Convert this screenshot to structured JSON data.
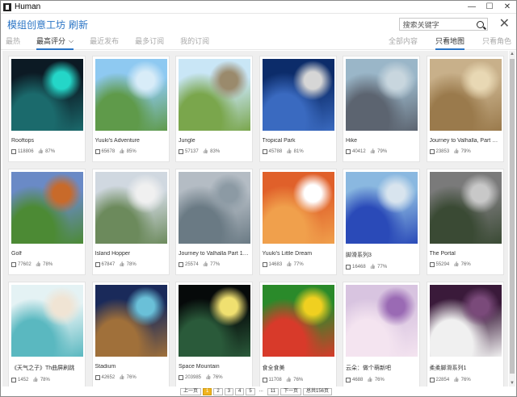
{
  "window": {
    "title": "Human",
    "minimize": "—",
    "maximize": "☐",
    "close": "✕"
  },
  "header": {
    "title": "模组创意工坊",
    "refresh": "刷新",
    "search_placeholder": "搜索关键字",
    "close": "✕"
  },
  "tabs": [
    "最热",
    "最高评分",
    "最近发布",
    "最多订阅",
    "我的订阅"
  ],
  "active_tab": "最高评分",
  "right_tabs": [
    "全部内容",
    "只看地图",
    "只看角色"
  ],
  "active_right_tab": "只看地图",
  "cards": [
    {
      "title": "Rooftops",
      "subs": "118806",
      "rating": "87%",
      "colors": [
        "#0c1a24",
        "#1b6a6c",
        "#24d6c8"
      ]
    },
    {
      "title": "Yuuki's Adventure",
      "subs": "65678",
      "rating": "85%",
      "colors": [
        "#8ec9f1",
        "#5f9a4a",
        "#d8ecf8"
      ]
    },
    {
      "title": "Jungle",
      "subs": "57137",
      "rating": "83%",
      "colors": [
        "#c9e6f6",
        "#7aa64c",
        "#9a8a6c"
      ]
    },
    {
      "title": "Tropical Park",
      "subs": "45788",
      "rating": "81%",
      "colors": [
        "#0c2c6a",
        "#3a6ac0",
        "#d6d6d6"
      ]
    },
    {
      "title": "Hike",
      "subs": "40412",
      "rating": "79%",
      "colors": [
        "#9ab6c8",
        "#5c6470",
        "#c8d6de"
      ]
    },
    {
      "title": "Journey to Valhalla, Part 6 (Jot...",
      "subs": "23853",
      "rating": "79%",
      "colors": [
        "#c8b08a",
        "#9a7a4c",
        "#e8d8b4"
      ]
    },
    {
      "title": "Golf",
      "subs": "77602",
      "rating": "78%",
      "colors": [
        "#6a8ac6",
        "#4c8a34",
        "#c86a2a"
      ]
    },
    {
      "title": "Island Hopper",
      "subs": "67847",
      "rating": "78%",
      "colors": [
        "#d0d8e0",
        "#6c8a5c",
        "#f0f0f0"
      ]
    },
    {
      "title": "Journey to Valhalla Part 1 (Mi...",
      "subs": "25574",
      "rating": "77%",
      "colors": [
        "#b4bcc4",
        "#6a7a84",
        "#8c9aa4"
      ]
    },
    {
      "title": "Yuuki's Little Dream",
      "subs": "14683",
      "rating": "77%",
      "colors": [
        "#e0602a",
        "#f0a04c",
        "#ffffff"
      ]
    },
    {
      "title": "脚滑系列3",
      "subs": "16468",
      "rating": "77%",
      "colors": [
        "#8ab8e0",
        "#2a4ab8",
        "#d8e4ee"
      ]
    },
    {
      "title": "The Portal",
      "subs": "55294",
      "rating": "76%",
      "colors": [
        "#7a7a7a",
        "#3a4a34",
        "#c8c8c8"
      ]
    },
    {
      "title": "《天气之子》Th曲屏刷跳",
      "subs": "1452",
      "rating": "78%",
      "colors": [
        "#e4f2f4",
        "#5ab8c0",
        "#f0e4d4"
      ]
    },
    {
      "title": "Stadium",
      "subs": "42652",
      "rating": "76%",
      "colors": [
        "#1a2a5a",
        "#a0703a",
        "#6ac0d8"
      ]
    },
    {
      "title": "Space Mountain",
      "subs": "203985",
      "rating": "76%",
      "colors": [
        "#060a0a",
        "#2a5a3a",
        "#f0e070"
      ]
    },
    {
      "title": "食全食美",
      "subs": "11708",
      "rating": "76%",
      "colors": [
        "#2a8a2a",
        "#d83a2a",
        "#f0d020"
      ]
    },
    {
      "title": "云朵：做个萌新吧",
      "subs": "4688",
      "rating": "76%",
      "colors": [
        "#d8c4e0",
        "#f4e4f0",
        "#9a6ab4"
      ]
    },
    {
      "title": "柔柔脚滑系列1",
      "subs": "22854",
      "rating": "76%",
      "colors": [
        "#3a1a3a",
        "#f0f0f0",
        "#7a4a7a"
      ]
    }
  ],
  "pagination": {
    "prev": "上一页",
    "pages": [
      "1",
      "2",
      "3",
      "4",
      "5",
      "...",
      "11"
    ],
    "active": "1",
    "next": "下一页",
    "total": "总共156页"
  }
}
